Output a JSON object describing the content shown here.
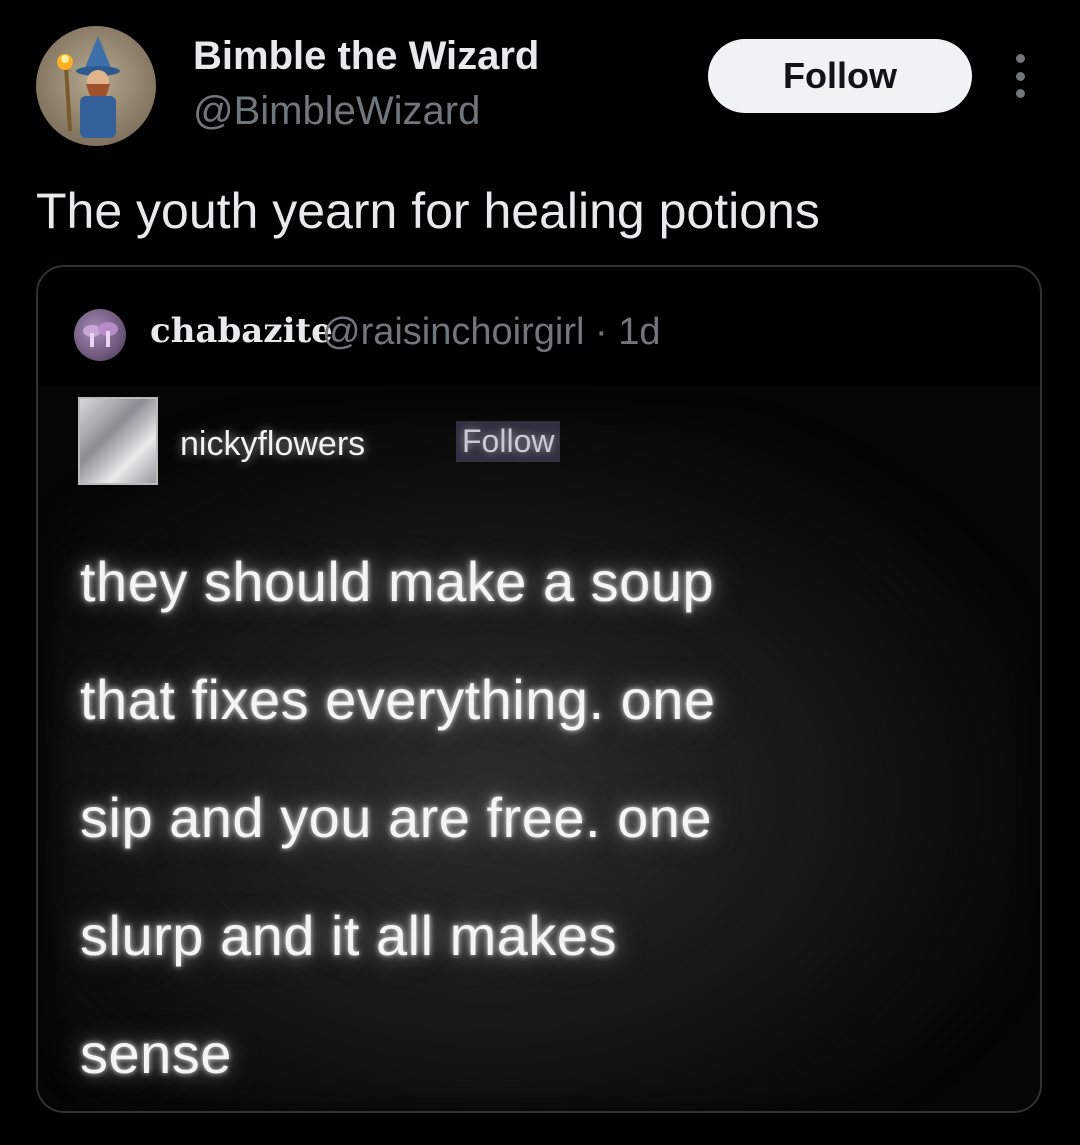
{
  "post": {
    "author": {
      "display_name": "Bimble the Wizard",
      "handle": "@BimbleWizard",
      "avatar_icon": "wizard-avatar"
    },
    "follow_label": "Follow",
    "more_icon": "more-vertical-icon",
    "text": "The youth yearn for healing potions"
  },
  "quote": {
    "display_name": "chabazite",
    "handle_time": "@raisinchoirgirl · 1d",
    "image": {
      "username": "nickyflowers",
      "follow_label": "Follow",
      "text": "they should make a soup\nthat fixes everything. one\nsip and you are free. one\nslurp and it all makes\nsense"
    }
  },
  "colors": {
    "background": "#000000",
    "primary_text": "#e7e9ea",
    "secondary_text": "#71767b",
    "follow_button_bg": "#eff3f4",
    "border": "#2f3336"
  }
}
